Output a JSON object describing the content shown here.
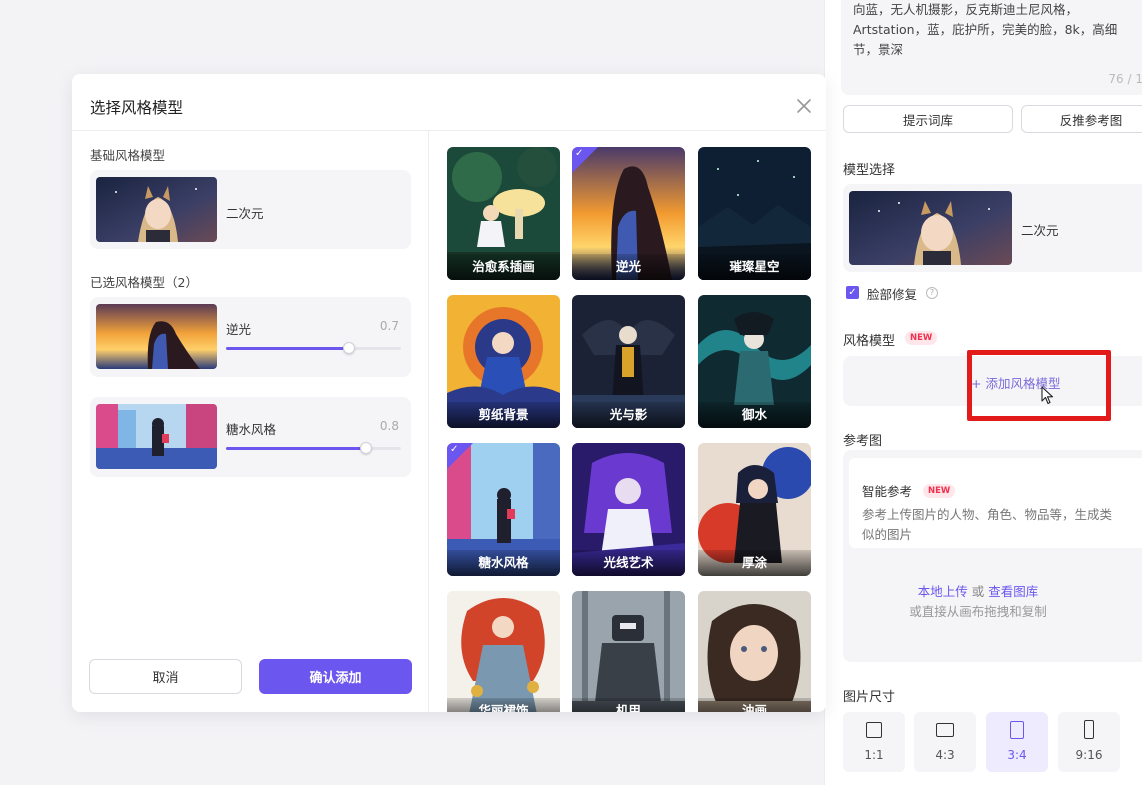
{
  "right_panel": {
    "prompt_text": "向蓝，无人机摄影，反克斯迪土尼风格，Artstation，蓝，庇护所，完美的脸，8k，高细节，景深",
    "prompt_count": "76 / 1",
    "prompt_library_button": "提示词库",
    "reverse_ref_button": "反推参考图",
    "model_section_title": "模型选择",
    "model_name": "二次元",
    "face_fix_label": "脸部修复",
    "help_icon": "?",
    "style_section_title": "风格模型",
    "new_badge": "NEW",
    "add_style_button": "+ 添加风格模型",
    "ref_section_title": "参考图",
    "smart_ref_title": "智能参考",
    "smart_ref_desc": "参考上传图片的人物、角色、物品等，生成类似的图片",
    "upload_local": "本地上传",
    "upload_or": " 或 ",
    "view_gallery": "查看图库",
    "drag_hint": "或直接从画布拖拽和复制",
    "size_section_title": "图片尺寸",
    "sizes": [
      {
        "label": "1:1"
      },
      {
        "label": "4:3"
      },
      {
        "label": "3:4",
        "active": true
      },
      {
        "label": "9:16"
      }
    ]
  },
  "modal": {
    "title": "选择风格模型",
    "base_heading": "基础风格模型",
    "base_model_name": "二次元",
    "selected_heading": "已选风格模型（2）",
    "selected": [
      {
        "name": "逆光",
        "value": "0.7",
        "level": 0.7
      },
      {
        "name": "糖水风格",
        "value": "0.8",
        "level": 0.8
      }
    ],
    "cancel_button": "取消",
    "confirm_button": "确认添加",
    "check_mark": "✓",
    "tiles": [
      {
        "label": "治愈系插画",
        "selected": false
      },
      {
        "label": "逆光",
        "selected": true
      },
      {
        "label": "璀璨星空",
        "selected": false
      },
      {
        "label": "剪纸背景",
        "selected": false
      },
      {
        "label": "光与影",
        "selected": false
      },
      {
        "label": "御水",
        "selected": false
      },
      {
        "label": "糖水风格",
        "selected": true
      },
      {
        "label": "光线艺术",
        "selected": false
      },
      {
        "label": "厚涂",
        "selected": false
      },
      {
        "label": "华丽裙饰",
        "selected": false
      },
      {
        "label": "机甲",
        "selected": false
      },
      {
        "label": "油画",
        "selected": false
      }
    ]
  },
  "colors": {
    "accent": "#6b57f0",
    "highlight_red": "#e21a1a",
    "new_badge": "#f0304f"
  }
}
